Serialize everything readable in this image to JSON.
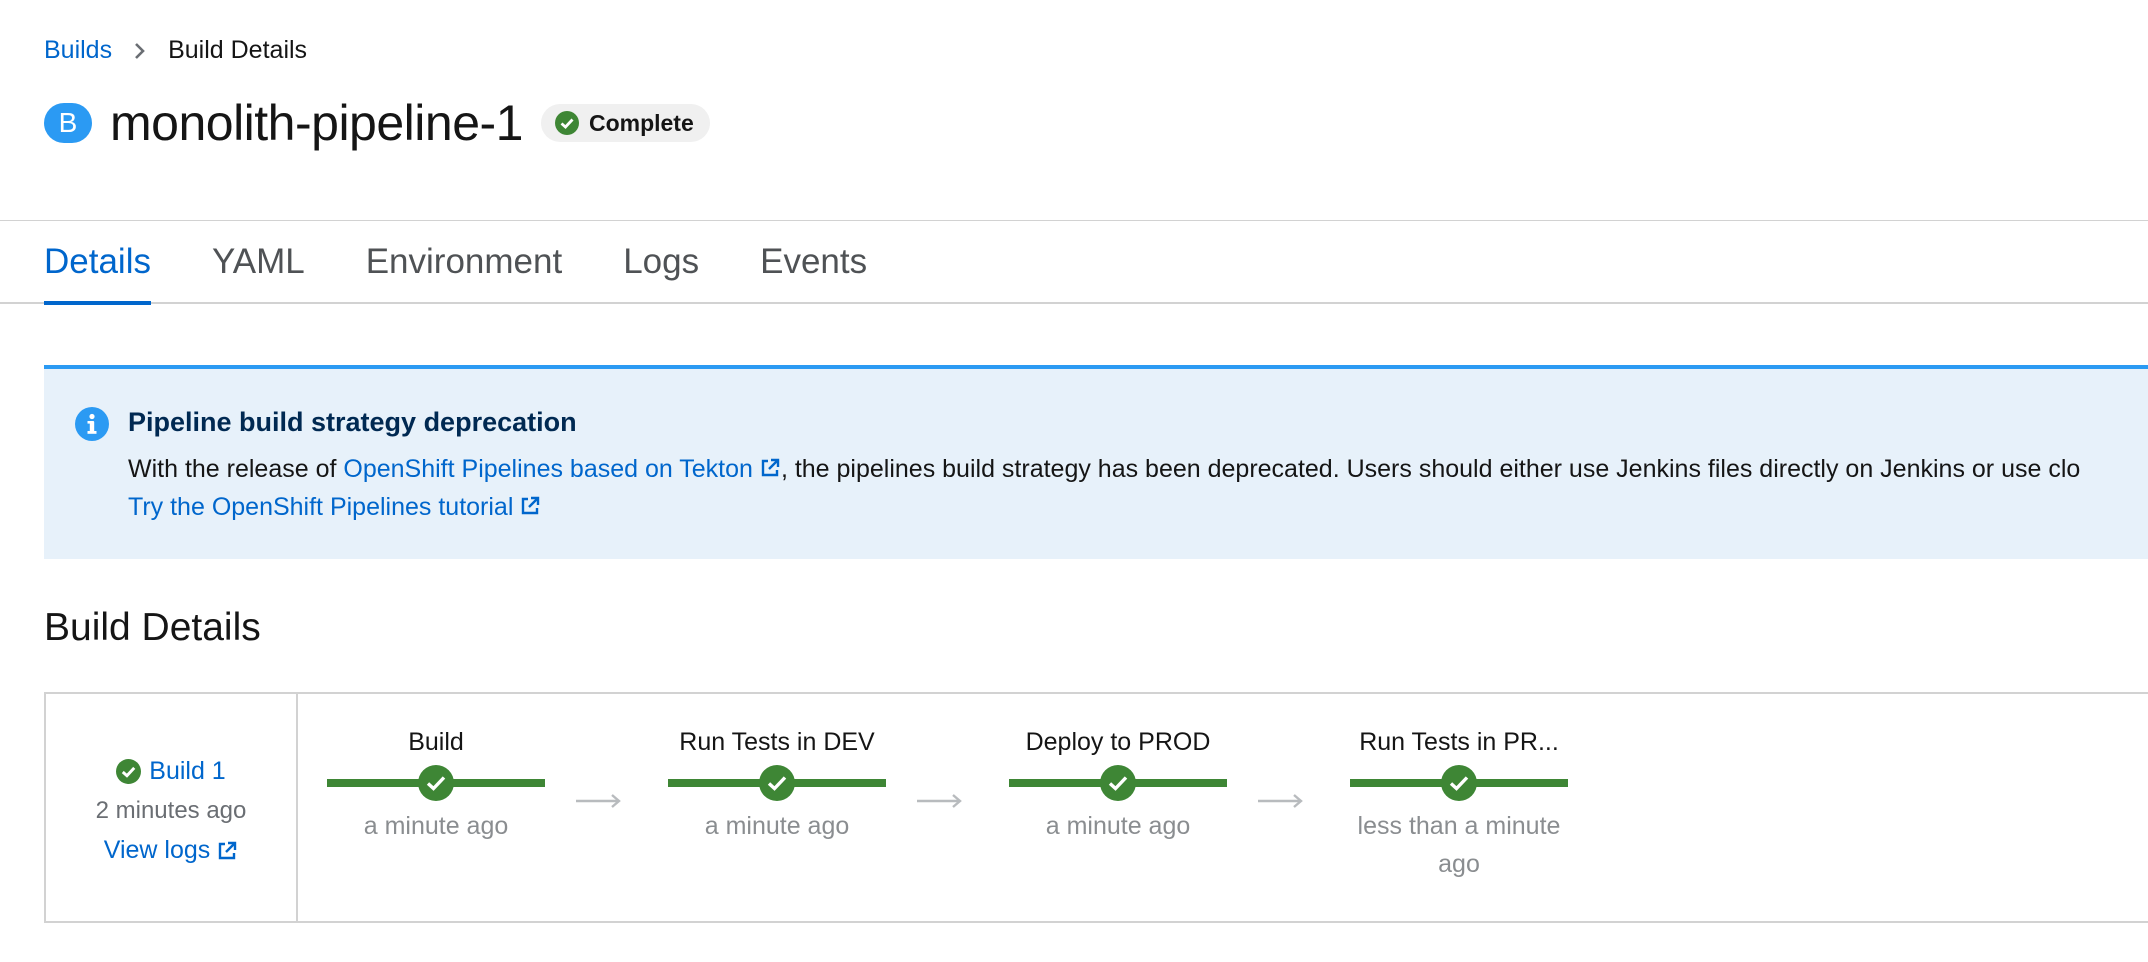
{
  "breadcrumb": {
    "parent": "Builds",
    "current": "Build Details"
  },
  "header": {
    "badge_letter": "B",
    "title": "monolith-pipeline-1",
    "status": "Complete"
  },
  "tabs": [
    {
      "label": "Details",
      "active": true
    },
    {
      "label": "YAML",
      "active": false
    },
    {
      "label": "Environment",
      "active": false
    },
    {
      "label": "Logs",
      "active": false
    },
    {
      "label": "Events",
      "active": false
    }
  ],
  "alert": {
    "title": "Pipeline build strategy deprecation",
    "text_before_link": "With the release of ",
    "link_text": "OpenShift Pipelines based on Tekton",
    "text_after_link": ", the pipelines build strategy has been deprecated. Users should either use Jenkins files directly on Jenkins or use clo",
    "tutorial_link": "Try the OpenShift Pipelines tutorial"
  },
  "section": {
    "title": "Build Details"
  },
  "build": {
    "name": "Build 1",
    "time": "2 minutes ago",
    "view_logs": "View logs"
  },
  "stages": [
    {
      "name": "Build",
      "time": "a minute ago"
    },
    {
      "name": "Run Tests in DEV",
      "time": "a minute ago"
    },
    {
      "name": "Deploy to PROD",
      "time": "a minute ago"
    },
    {
      "name": "Run Tests in PR...",
      "time": "less than a minute ago"
    }
  ],
  "colors": {
    "link": "#0066cc",
    "success": "#3e8635",
    "info": "#2b9af3",
    "alert_bg": "#e7f1fa"
  },
  "icons": {
    "breadcrumb_separator": "chevron-right-icon",
    "status": "check-circle-icon",
    "alert": "info-circle-icon",
    "external": "external-link-icon",
    "stage_status": "check-circle-icon",
    "stage_connector": "arrow-right-icon"
  }
}
